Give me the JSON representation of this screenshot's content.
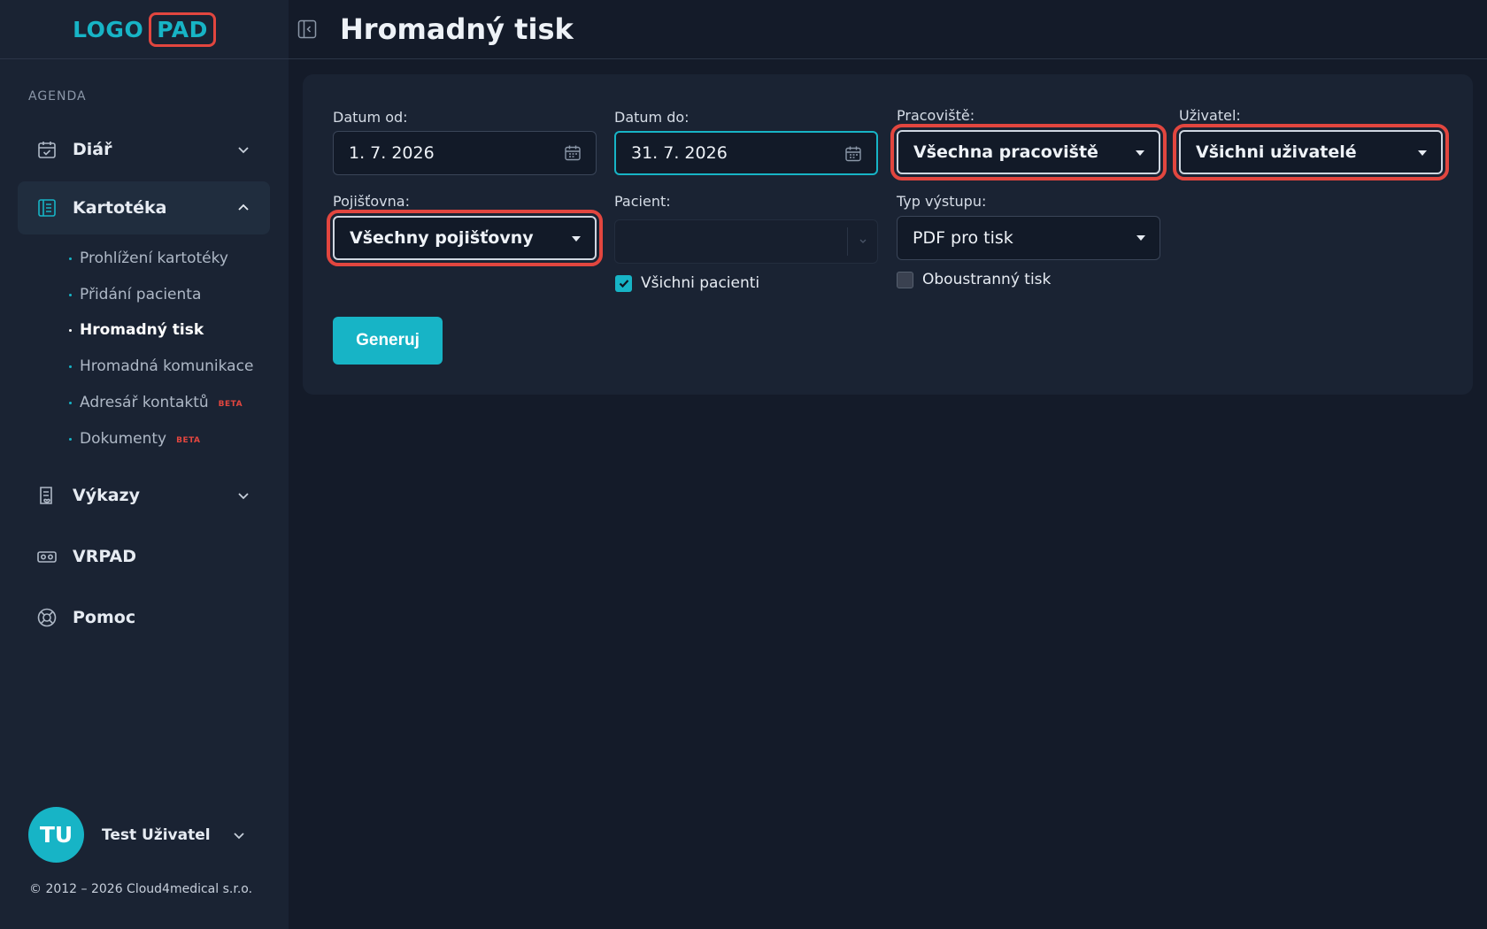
{
  "logo": {
    "part1": "LOGO",
    "part2": "PAD"
  },
  "sidebar": {
    "section_label": "AGENDA",
    "items": [
      {
        "label": "Diář",
        "icon": "calendar-check-icon",
        "expanded": false
      },
      {
        "label": "Kartotéka",
        "icon": "card-file-icon",
        "expanded": true
      },
      {
        "label": "Výkazy",
        "icon": "report-icon",
        "expanded": false
      },
      {
        "label": "VRPAD",
        "icon": "vr-headset-icon"
      },
      {
        "label": "Pomoc",
        "icon": "lifebuoy-icon"
      }
    ],
    "subitems": [
      {
        "label": "Prohlížení kartotéky"
      },
      {
        "label": "Přidání pacienta"
      },
      {
        "label": "Hromadný tisk",
        "current": true
      },
      {
        "label": "Hromadná komunikace"
      },
      {
        "label": "Adresář kontaktů",
        "badge": "BETA"
      },
      {
        "label": "Dokumenty",
        "badge": "BETA"
      }
    ],
    "user": {
      "initials": "TU",
      "name": "Test Uživatel"
    },
    "copyright": "© 2012 – 2026 Cloud4medical s.r.o."
  },
  "header": {
    "title": "Hromadný tisk"
  },
  "form": {
    "date_from": {
      "label": "Datum od:",
      "value": "1. 7. 2026"
    },
    "date_to": {
      "label": "Datum do:",
      "value": "31. 7. 2026"
    },
    "workplace": {
      "label": "Pracoviště:",
      "value": "Všechna pracoviště"
    },
    "user": {
      "label": "Uživatel:",
      "value": "Všichni uživatelé"
    },
    "insurance": {
      "label": "Pojišťovna:",
      "value": "Všechny pojišťovny"
    },
    "patient": {
      "label": "Pacient:",
      "value": ""
    },
    "all_patients": {
      "label": "Všichni pacienti",
      "checked": true
    },
    "output_type": {
      "label": "Typ výstupu:",
      "value": "PDF pro tisk"
    },
    "duplex": {
      "label": "Oboustranný tisk",
      "checked": false
    },
    "generate_label": "Generuj"
  },
  "colors": {
    "accent": "#17b4c6",
    "highlight": "#e2463f",
    "background": "#141b29",
    "panel": "#1a2333"
  }
}
